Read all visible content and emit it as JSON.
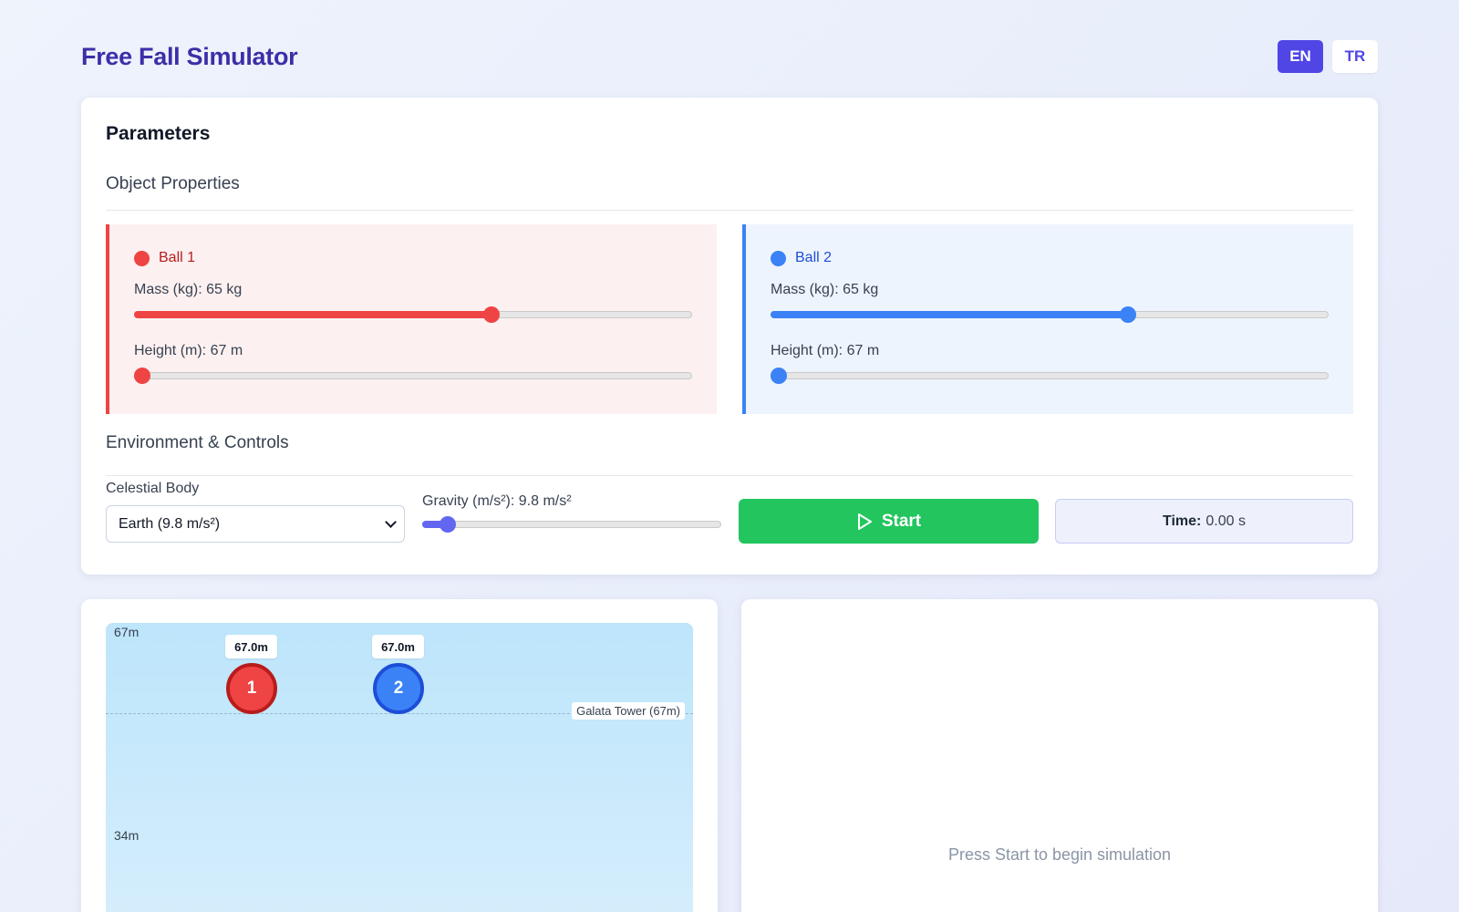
{
  "header": {
    "title": "Free Fall Simulator",
    "languages": [
      {
        "label": "EN",
        "active": true
      },
      {
        "label": "TR",
        "active": false
      }
    ]
  },
  "parameters": {
    "title": "Parameters",
    "object_section_title": "Object Properties",
    "balls": [
      {
        "name": "Ball 1",
        "color": "#ef4444",
        "mass_label": "Mass (kg): 65 kg",
        "mass_value": 65,
        "mass_fraction": 0.645,
        "height_label": "Height (m): 67 m",
        "height_value": 67,
        "height_fraction": 0.0
      },
      {
        "name": "Ball 2",
        "color": "#3b82f6",
        "mass_label": "Mass (kg): 65 kg",
        "mass_value": 65,
        "mass_fraction": 0.645,
        "height_label": "Height (m): 67 m",
        "height_value": 67,
        "height_fraction": 0.0
      }
    ],
    "environment_section_title": "Environment & Controls",
    "celestial_body_label": "Celestial Body",
    "celestial_body_selected": "Earth (9.8 m/s²)",
    "gravity_label": "Gravity (m/s²): 9.8 m/s²",
    "gravity_value": 9.8,
    "gravity_fraction": 0.06,
    "start_label": "Start",
    "time_label": "Time:",
    "time_value": "0.00 s"
  },
  "simulation": {
    "axis_top": "67m",
    "axis_mid": "34m",
    "reference_label": "Galata Tower (67m)",
    "ball1_number": "1",
    "ball1_height": "67.0m",
    "ball2_number": "2",
    "ball2_height": "67.0m"
  },
  "results": {
    "placeholder": "Press Start to begin simulation"
  },
  "icons": {
    "start": "play-icon",
    "select": "chevron-down-icon"
  }
}
